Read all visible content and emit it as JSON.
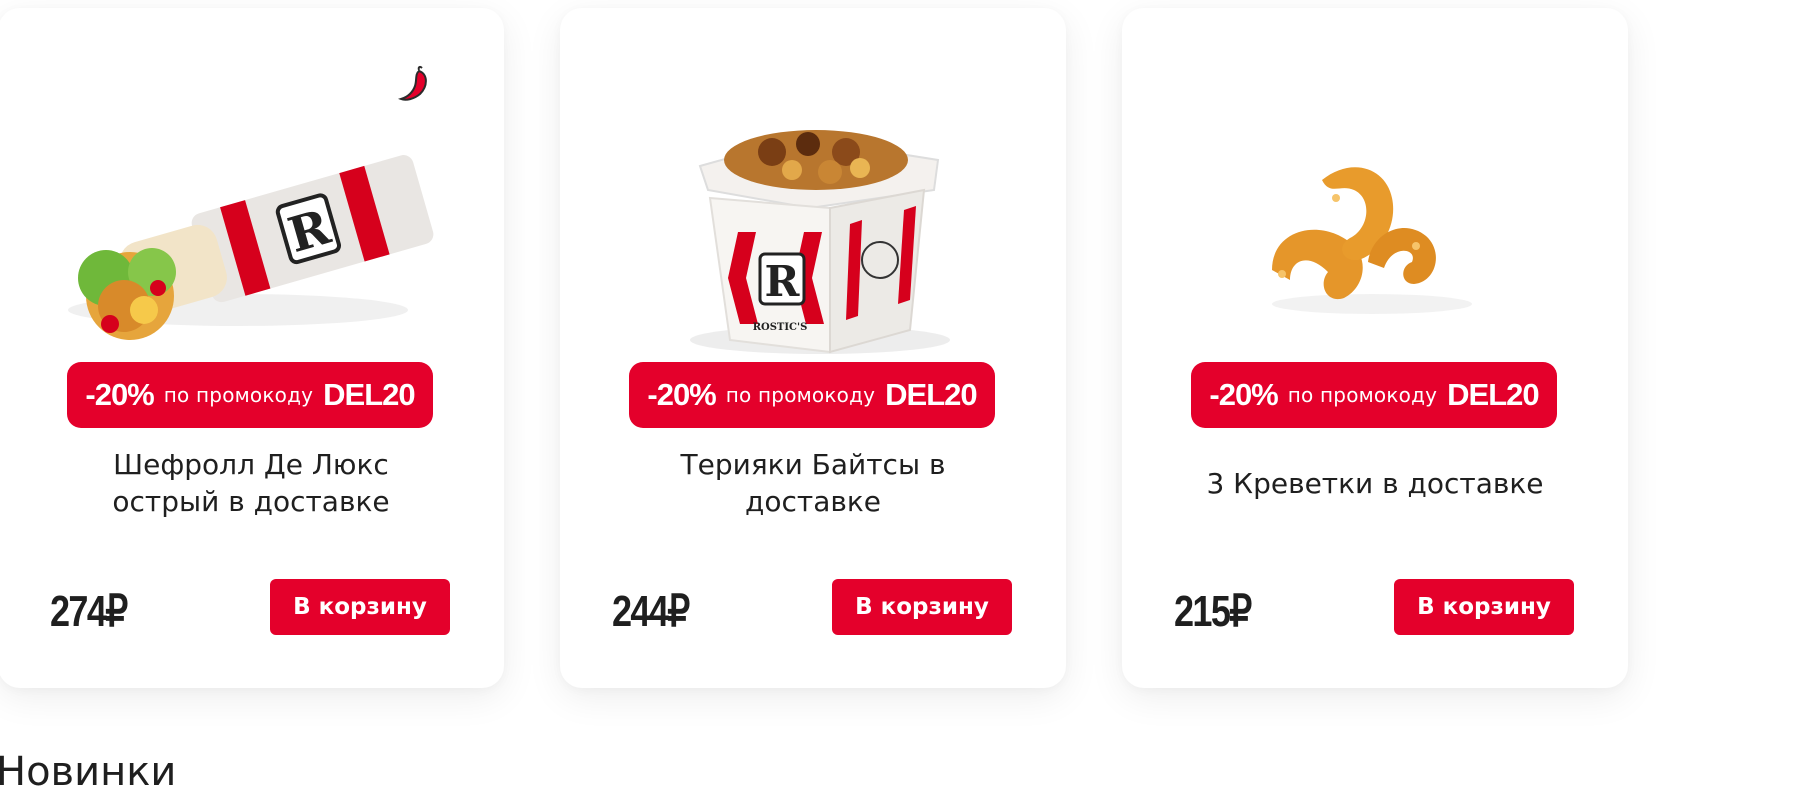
{
  "products": [
    {
      "promo": {
        "discount": "-20%",
        "text": "по промокоду",
        "code": "DEL20"
      },
      "title": "Шефролл Де Люкс острый в доставке",
      "price": "274₽",
      "button_label": "В корзину",
      "spicy": true,
      "image": "wrap-image"
    },
    {
      "promo": {
        "discount": "-20%",
        "text": "по промокоду",
        "code": "DEL20"
      },
      "title": "Терияки Байтсы в доставке",
      "price": "244₽",
      "button_label": "В корзину",
      "spicy": false,
      "image": "teriyaki-box-image"
    },
    {
      "promo": {
        "discount": "-20%",
        "text": "по промокоду",
        "code": "DEL20"
      },
      "title": "3 Креветки в доставке",
      "price": "215₽",
      "button_label": "В корзину",
      "spicy": false,
      "image": "shrimp-image"
    }
  ],
  "section": {
    "title": "Новинки"
  },
  "colors": {
    "brand_red": "#e4002b",
    "text": "#1f1f1f",
    "card_bg": "#ffffff"
  }
}
